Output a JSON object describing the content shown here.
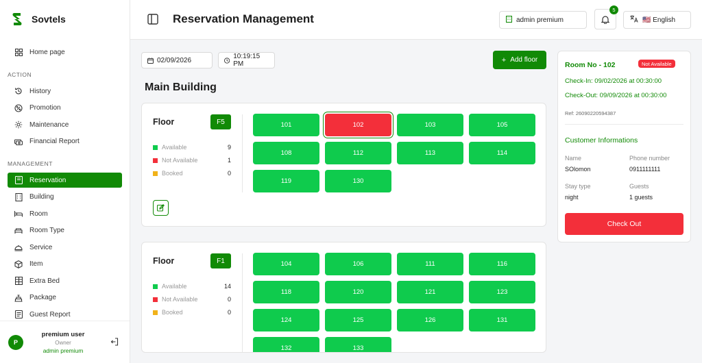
{
  "brand": {
    "name": "Sovtels",
    "color": "#118a06"
  },
  "sidebar": {
    "home": "Home page",
    "section_action": "ACTION",
    "action_items": [
      {
        "label": "History",
        "icon": "history-icon"
      },
      {
        "label": "Promotion",
        "icon": "promotion-icon"
      },
      {
        "label": "Maintenance",
        "icon": "gear-icon"
      },
      {
        "label": "Financial Report",
        "icon": "money-icon"
      }
    ],
    "section_management": "MANAGEMENT",
    "management_items": [
      {
        "label": "Reservation",
        "icon": "reservation-icon",
        "active": true
      },
      {
        "label": "Building",
        "icon": "building-icon"
      },
      {
        "label": "Room",
        "icon": "bed-icon"
      },
      {
        "label": "Room Type",
        "icon": "room-type-icon"
      },
      {
        "label": "Service",
        "icon": "bell-service-icon"
      },
      {
        "label": "Item",
        "icon": "box-icon"
      },
      {
        "label": "Extra Bed",
        "icon": "extra-bed-icon"
      },
      {
        "label": "Package",
        "icon": "package-icon"
      },
      {
        "label": "Guest Report",
        "icon": "report-icon"
      }
    ],
    "user": {
      "initial": "P",
      "name": "premium user",
      "role": "Owner",
      "plan": "admin premium"
    }
  },
  "header": {
    "title": "Reservation Management",
    "account_label": "admin premium",
    "notification_count": "5",
    "language": "🇺🇸 English"
  },
  "toolbar": {
    "date": "02/09/2026",
    "time": "10:19:15 PM",
    "add_floor": "Add floor"
  },
  "building": {
    "name": "Main Building",
    "floors": [
      {
        "label": "Floor",
        "badge": "F5",
        "legend": [
          {
            "label": "Available",
            "count": "9",
            "color": "#0fcb4d"
          },
          {
            "label": "Not Available",
            "count": "1",
            "color": "#f32f3a"
          },
          {
            "label": "Booked",
            "count": "0",
            "color": "#f1b21a"
          }
        ],
        "rooms": [
          {
            "number": "101",
            "status": "available"
          },
          {
            "number": "102",
            "status": "unavailable"
          },
          {
            "number": "103",
            "status": "available"
          },
          {
            "number": "105",
            "status": "available"
          },
          {
            "number": "108",
            "status": "available"
          },
          {
            "number": "112",
            "status": "available"
          },
          {
            "number": "113",
            "status": "available"
          },
          {
            "number": "114",
            "status": "available"
          },
          {
            "number": "119",
            "status": "available"
          },
          {
            "number": "130",
            "status": "available"
          }
        ]
      },
      {
        "label": "Floor",
        "badge": "F1",
        "legend": [
          {
            "label": "Available",
            "count": "14",
            "color": "#0fcb4d"
          },
          {
            "label": "Not Available",
            "count": "0",
            "color": "#f32f3a"
          },
          {
            "label": "Booked",
            "count": "0",
            "color": "#f1b21a"
          }
        ],
        "rooms": [
          {
            "number": "104",
            "status": "available"
          },
          {
            "number": "106",
            "status": "available"
          },
          {
            "number": "111",
            "status": "available"
          },
          {
            "number": "116",
            "status": "available"
          },
          {
            "number": "118",
            "status": "available"
          },
          {
            "number": "120",
            "status": "available"
          },
          {
            "number": "121",
            "status": "available"
          },
          {
            "number": "123",
            "status": "available"
          },
          {
            "number": "124",
            "status": "available"
          },
          {
            "number": "125",
            "status": "available"
          },
          {
            "number": "126",
            "status": "available"
          },
          {
            "number": "131",
            "status": "available"
          },
          {
            "number": "132",
            "status": "available"
          },
          {
            "number": "133",
            "status": "available"
          }
        ]
      }
    ]
  },
  "detail": {
    "room_no": "Room No - 102",
    "status": "Not Available",
    "check_in": "Check-In: 09/02/2026 at 00:30:00",
    "check_out": "Check-Out: 09/09/2026 at 00:30:00",
    "ref": "Ref: 26090220594387",
    "customer_title": "Customer Informations",
    "name_label": "Name",
    "name_value": "SOlomon",
    "phone_label": "Phone number",
    "phone_value": "0911111111",
    "stay_label": "Stay type",
    "stay_value": "night",
    "guests_label": "Guests",
    "guests_value": "1 guests",
    "checkout_label": "Check Out"
  }
}
